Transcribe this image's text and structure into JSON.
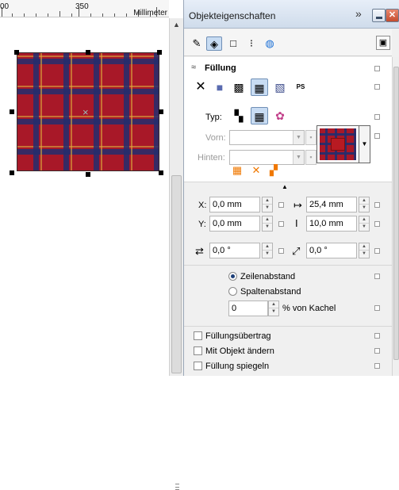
{
  "ruler": {
    "mark_0": "00",
    "mark_350": "350",
    "unit": "Millimeter"
  },
  "canvas": {
    "center_marker": "×"
  },
  "docker": {
    "title": "Objekteigenschaften",
    "expand_glyph": "»",
    "minimize_label": "",
    "close_label": "✕",
    "tabs": [
      {
        "icon": "pen-outline-icon",
        "glyph": "✎",
        "selected": false
      },
      {
        "icon": "fill-bucket-icon",
        "glyph": "◈",
        "selected": true
      },
      {
        "icon": "rectangle-icon",
        "glyph": "□",
        "selected": false
      },
      {
        "icon": "text-frame-icon",
        "glyph": "⁝",
        "selected": false
      },
      {
        "icon": "internet-globe-icon",
        "glyph": "◍",
        "selected": false
      }
    ],
    "settings_glyph": "▣"
  },
  "fill": {
    "section_title": "Füllung",
    "collapse_glyph": "≈",
    "types": [
      {
        "name": "no-fill",
        "glyph": "✕",
        "selected": false
      },
      {
        "name": "uniform-fill",
        "glyph": "■",
        "selected": false
      },
      {
        "name": "fountain-fill",
        "glyph": "▩",
        "selected": false
      },
      {
        "name": "pattern-fill",
        "glyph": "▦",
        "selected": true
      },
      {
        "name": "texture-fill",
        "glyph": "▧",
        "selected": false
      },
      {
        "name": "postscript-fill",
        "glyph": "PS",
        "selected": false
      }
    ],
    "typ_label": "Typ:",
    "pattern_types": [
      {
        "name": "two-color-pattern",
        "glyph": "▚",
        "selected": false
      },
      {
        "name": "full-color-pattern",
        "glyph": "▦",
        "selected": true
      },
      {
        "name": "bitmap-pattern",
        "glyph": "✿",
        "selected": false
      }
    ],
    "front_label": "Vorn:",
    "back_label": "Hinten:",
    "front_value": "",
    "back_value": "",
    "pattern_controls": [
      {
        "name": "tile-mirror",
        "glyph": "▦"
      },
      {
        "name": "tile-offset",
        "glyph": "✕"
      },
      {
        "name": "tile-flip",
        "glyph": "▞"
      }
    ],
    "colors": {
      "pattern_red": "#a81828",
      "pattern_navy": "#232d6e",
      "pattern_gold": "#dcaa3c",
      "accent_orange": "#f07800"
    }
  },
  "transform": {
    "caret": "▲",
    "x_label": "X:",
    "x_value": "0,0 mm",
    "y_label": "Y:",
    "y_value": "0,0 mm",
    "width_value": "25,4 mm",
    "height_value": "10,0 mm",
    "rotate_value": "0,0 °",
    "skew_value": "0,0 °"
  },
  "spacing": {
    "row_label": "Zeilenabstand",
    "row_selected": true,
    "column_label": "Spaltenabstand",
    "column_selected": false,
    "percent_value": "0",
    "percent_label": "% von Kachel"
  },
  "options": {
    "transform_fill": "Füllungsübertrag",
    "transform_fill_checked": false,
    "change_with_object": "Mit Objekt ändern",
    "change_with_object_checked": false,
    "mirror_fill": "Füllung spiegeln",
    "mirror_fill_checked": false
  }
}
